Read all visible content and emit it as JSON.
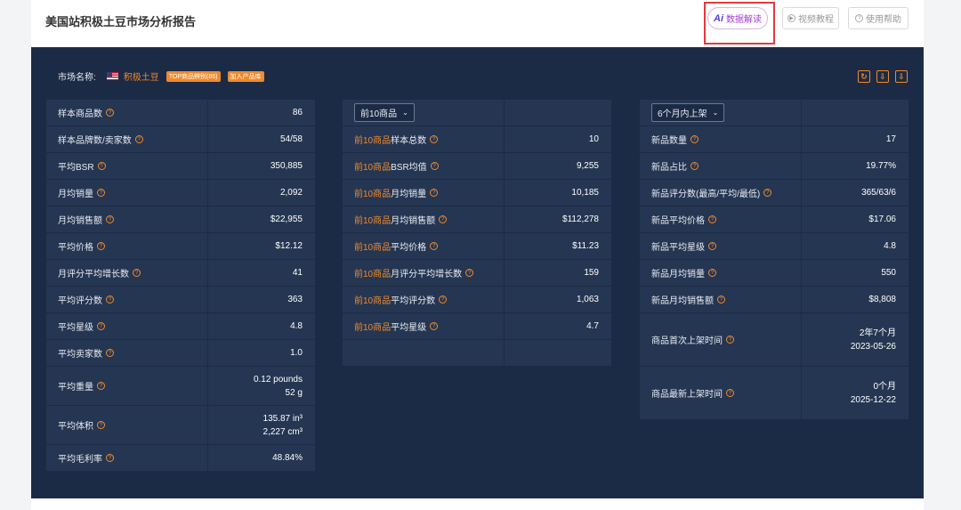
{
  "header": {
    "title": "美国站积极土豆市场分析报告",
    "ai_badge": "Ai",
    "ai_label": "数据解读",
    "video_label": "视频教程",
    "help_label": "使用帮助"
  },
  "market": {
    "label": "市场名称:",
    "name": "积极土豆",
    "tag_top": "TOP商品辨别(86)",
    "tag_add": "加入产品库"
  },
  "icons": {
    "refresh": "refresh-icon",
    "download1": "download-icon",
    "download2": "export-icon"
  },
  "colors": {
    "panel_bg": "#1c2b45",
    "cell_bg": "#253652",
    "accent": "#f08a2c",
    "highlight": "#e4393c"
  },
  "col_a": [
    {
      "label": "样本商品数",
      "value": "86"
    },
    {
      "label": "样本品牌数/卖家数",
      "value": "54/58"
    },
    {
      "label": "平均BSR",
      "value": "350,885"
    },
    {
      "label": "月均销量",
      "value": "2,092"
    },
    {
      "label": "月均销售额",
      "value": "$22,955"
    },
    {
      "label": "平均价格",
      "value": "$12.12"
    },
    {
      "label": "月评分平均增长数",
      "value": "41"
    },
    {
      "label": "平均评分数",
      "value": "363"
    },
    {
      "label": "平均星级",
      "value": "4.8"
    },
    {
      "label": "平均卖家数",
      "value": "1.0"
    },
    {
      "label": "平均重量",
      "value": "0.12 pounds",
      "value2": "52 g"
    },
    {
      "label": "平均体积",
      "value": "135.87 in³",
      "value2": "2,227 cm³"
    },
    {
      "label": "平均毛利率",
      "value": "48.84%"
    }
  ],
  "col_b": {
    "select": "前10商品",
    "prefix": "前10商品",
    "rows": [
      {
        "label": "样本总数",
        "value": "10"
      },
      {
        "label": "BSR均值",
        "value": "9,255"
      },
      {
        "label": "月均销量",
        "value": "10,185"
      },
      {
        "label": "月均销售额",
        "value": "$112,278"
      },
      {
        "label": "平均价格",
        "value": "$11.23"
      },
      {
        "label": "月评分平均增长数",
        "value": "159"
      },
      {
        "label": "平均评分数",
        "value": "1,063"
      },
      {
        "label": "平均星级",
        "value": "4.7"
      }
    ]
  },
  "col_c": {
    "select": "6个月内上架",
    "rows": [
      {
        "label": "新品数量",
        "value": "17"
      },
      {
        "label": "新品占比",
        "value": "19.77%"
      },
      {
        "label": "新品评分数(最高/平均/最低)",
        "value": "365/63/6"
      },
      {
        "label": "新品平均价格",
        "value": "$17.06"
      },
      {
        "label": "新品平均星级",
        "value": "4.8"
      },
      {
        "label": "新品月均销量",
        "value": "550"
      },
      {
        "label": "新品月均销售额",
        "value": "$8,808"
      },
      {
        "label": "商品首次上架时间",
        "value": "2年7个月",
        "value2": "2023-05-26"
      },
      {
        "label": "商品最新上架时间",
        "value": "0个月",
        "value2": "2025-12-22"
      }
    ]
  }
}
